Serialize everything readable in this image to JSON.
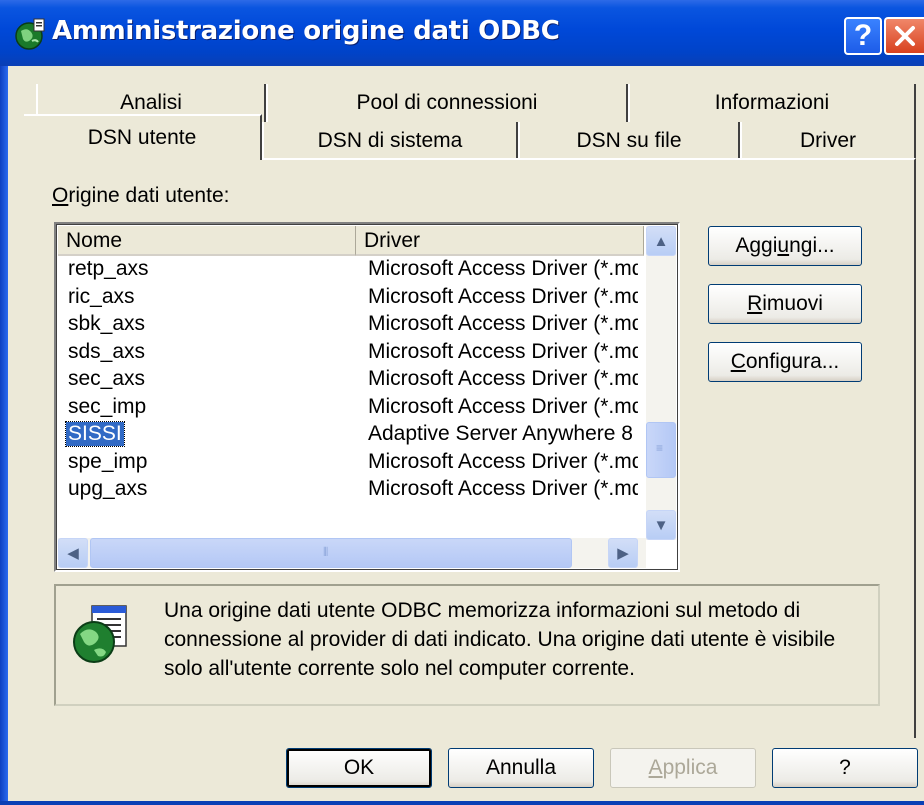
{
  "window": {
    "title": "Amministrazione origine dati ODBC"
  },
  "title_buttons": {
    "help": "?"
  },
  "tabs_row1": [
    "Analisi",
    "Pool di connessioni",
    "Informazioni"
  ],
  "tabs_row2": [
    "DSN utente",
    "DSN di sistema",
    "DSN su file",
    "Driver"
  ],
  "active_tab": "DSN utente",
  "list_label_first": "O",
  "list_label_rest": "rigine dati utente:",
  "list": {
    "columns": [
      "Nome",
      "Driver"
    ],
    "rows": [
      {
        "name": "retp_axs",
        "driver": "Microsoft Access Driver (*.mdb)"
      },
      {
        "name": "ric_axs",
        "driver": "Microsoft Access Driver (*.mdb)"
      },
      {
        "name": "sbk_axs",
        "driver": "Microsoft Access Driver (*.mdb)"
      },
      {
        "name": "sds_axs",
        "driver": "Microsoft Access Driver (*.mdb)"
      },
      {
        "name": "sec_axs",
        "driver": "Microsoft Access Driver (*.mdb)"
      },
      {
        "name": "sec_imp",
        "driver": "Microsoft Access Driver (*.mdb)"
      },
      {
        "name": "SISSI",
        "driver": "Adaptive Server Anywhere 8",
        "selected": true
      },
      {
        "name": "spe_imp",
        "driver": "Microsoft Access Driver (*.mdb)"
      },
      {
        "name": "upg_axs",
        "driver": "Microsoft Access Driver (*.mdb)"
      }
    ]
  },
  "side_buttons": {
    "add_pre": "Aggi",
    "add_ul": "u",
    "add_post": "ngi...",
    "remove_ul": "R",
    "remove_post": "imuovi",
    "configure_ul": "C",
    "configure_post": "onfigura..."
  },
  "info": {
    "icon": "odbc-datasource-globe-icon",
    "text": "Una origine dati utente ODBC memorizza informazioni sul metodo di connessione al provider di dati indicato. Una origine dati utente è visibile solo all'utente corrente solo nel computer corrente."
  },
  "bottom_buttons": {
    "ok": "OK",
    "cancel": "Annulla",
    "apply_ul": "A",
    "apply_post": "pplica",
    "help": "?"
  },
  "colors": {
    "titlebar": "#0048d8",
    "face": "#ece9d8",
    "selection": "#316ac5"
  }
}
